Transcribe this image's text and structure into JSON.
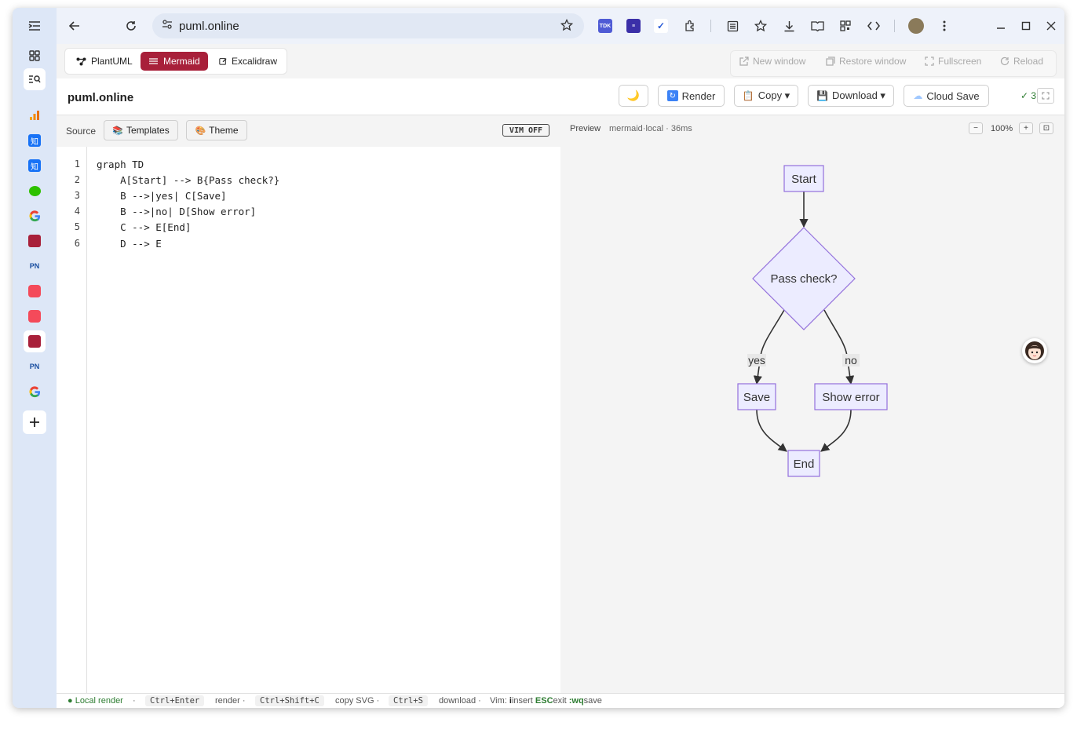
{
  "browser": {
    "url": "puml.online"
  },
  "modes": {
    "items": [
      {
        "label": "PlantUML"
      },
      {
        "label": "Mermaid"
      },
      {
        "label": "Excalidraw"
      }
    ]
  },
  "window_actions": {
    "new_window": "New window",
    "restore_window": "Restore window",
    "fullscreen": "Fullscreen",
    "reload": "Reload"
  },
  "appbar": {
    "title": "puml.online",
    "dark_mode": "🌙",
    "render": "Render",
    "copy": "Copy ▾",
    "download": "Download ▾",
    "cloud_save": "Cloud Save",
    "status": "✓ 3"
  },
  "editor_bar": {
    "source_label": "Source",
    "templates": "Templates",
    "theme": "Theme",
    "vim": "VIM OFF"
  },
  "editor": {
    "lines": [
      {
        "num": "1",
        "text": "graph TD"
      },
      {
        "num": "2",
        "text": "    A[Start] --> B{Pass check?}"
      },
      {
        "num": "3",
        "text": "    B -->|yes| C[Save]"
      },
      {
        "num": "4",
        "text": "    B -->|no| D[Show error]"
      },
      {
        "num": "5",
        "text": "    C --> E[End]"
      },
      {
        "num": "6",
        "text": "    D --> E"
      }
    ]
  },
  "preview_bar": {
    "label": "Preview",
    "meta": "mermaid·local · 36ms",
    "zoom_out": "−",
    "zoom": "100%",
    "zoom_in": "+",
    "fit": "⊡"
  },
  "diagram": {
    "start": "Start",
    "decision": "Pass check?",
    "yes": "yes",
    "no": "no",
    "save": "Save",
    "error": "Show error",
    "end": "End",
    "node_fill": "#ececff",
    "node_stroke": "#9370db"
  },
  "statusbar": {
    "local": "● Local render",
    "sep": "·",
    "k1": "Ctrl+Enter",
    "t1": "render ·",
    "k2": "Ctrl+Shift+C",
    "t2": "copy SVG ·",
    "k3": "Ctrl+S",
    "t3": "download ·",
    "vim_prefix": "Vim:",
    "vim_i": "i",
    "vim_insert": "insert",
    "vim_esc": "ESC",
    "vim_exit": "exit",
    "vim_wq": ":wq",
    "vim_save": "save"
  }
}
